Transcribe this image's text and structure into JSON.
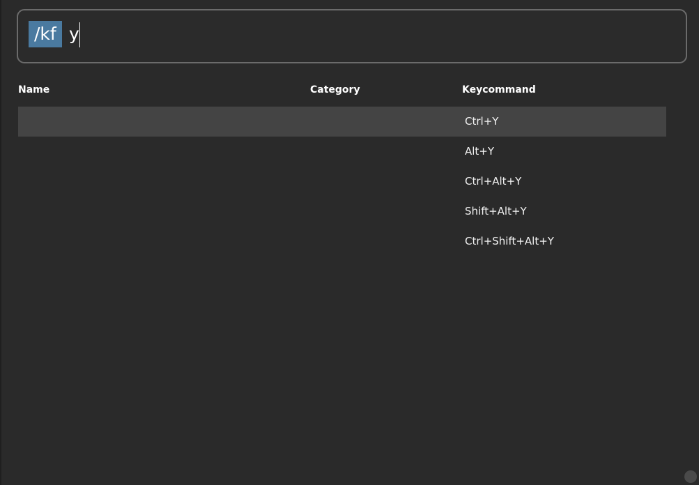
{
  "search": {
    "token": "/kf",
    "query": "y"
  },
  "columns": {
    "name": "Name",
    "category": "Category",
    "keycommand": "Keycommand"
  },
  "rows": [
    {
      "name": "",
      "category": "",
      "keycommand": "Ctrl+Y",
      "selected": true
    },
    {
      "name": "",
      "category": "",
      "keycommand": "Alt+Y",
      "selected": false
    },
    {
      "name": "",
      "category": "",
      "keycommand": "Ctrl+Alt+Y",
      "selected": false
    },
    {
      "name": "",
      "category": "",
      "keycommand": "Shift+Alt+Y",
      "selected": false
    },
    {
      "name": "",
      "category": "",
      "keycommand": "Ctrl+Shift+Alt+Y",
      "selected": false
    }
  ],
  "colors": {
    "background": "#2a2a2a",
    "selected_row": "#444444",
    "token_highlight": "#4a7aa0",
    "search_border": "#6b6b6b"
  }
}
